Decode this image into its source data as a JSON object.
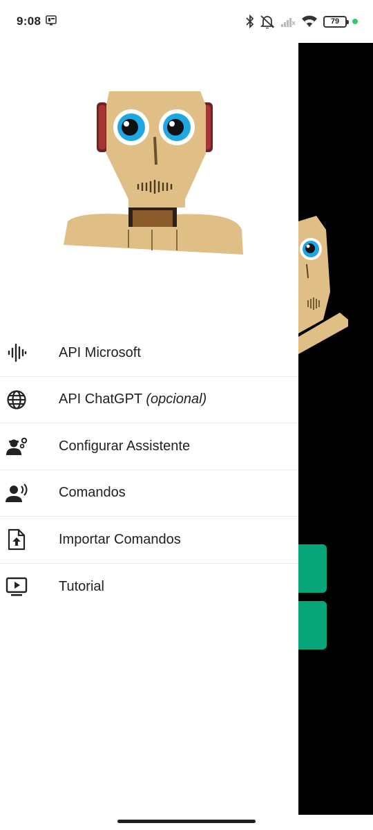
{
  "status_bar": {
    "time": "9:08",
    "battery": "79",
    "icons": [
      "notification-icon",
      "bluetooth-icon",
      "dnd-icon",
      "signal-icon",
      "wifi-icon",
      "battery-icon"
    ]
  },
  "drawer": {
    "menu_items": [
      {
        "icon": "audio-waveform-icon",
        "label": "API Microsoft",
        "suffix": ""
      },
      {
        "icon": "globe-icon",
        "label": "API ChatGPT ",
        "suffix": "(opcional)"
      },
      {
        "icon": "user-settings-icon",
        "label": "Configurar Assistente",
        "suffix": ""
      },
      {
        "icon": "voice-icon",
        "label": "Comandos",
        "suffix": ""
      },
      {
        "icon": "file-upload-icon",
        "label": "Importar Comandos",
        "suffix": ""
      },
      {
        "icon": "tutorial-video-icon",
        "label": "Tutorial",
        "suffix": ""
      }
    ]
  },
  "colors": {
    "accent_green": "#06a678",
    "robot_wood": "#e0bf86",
    "eye_blue": "#1ea7e1"
  }
}
